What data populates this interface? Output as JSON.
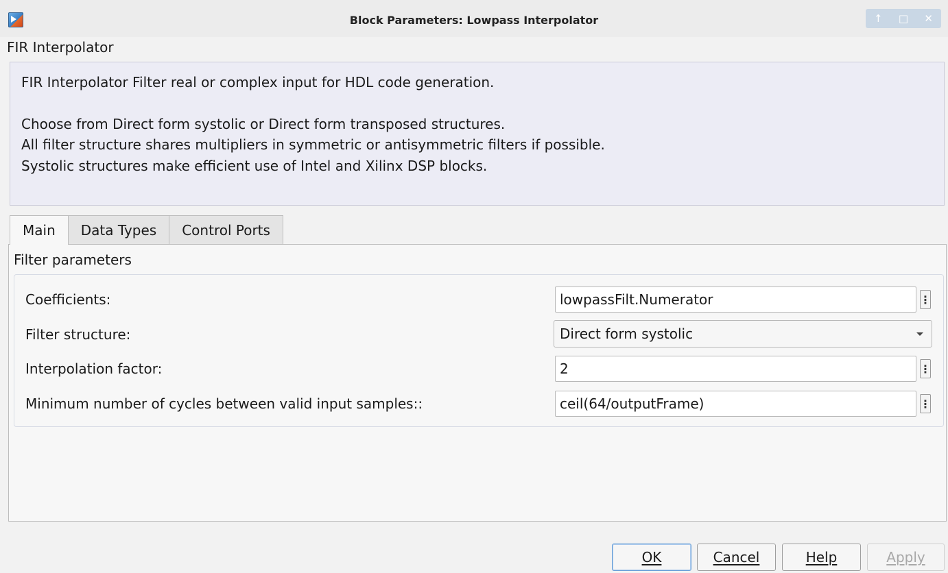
{
  "window": {
    "title": "Block Parameters: Lowpass Interpolator",
    "controls": {
      "minimize": "↑",
      "maximize": "□",
      "close": "✕"
    }
  },
  "block": {
    "name": "FIR Interpolator",
    "description": [
      "FIR Interpolator Filter real or complex input for HDL code generation.",
      "Choose from Direct form systolic or Direct form transposed structures.",
      "All filter structure shares multipliers in symmetric or antisymmetric filters if possible.",
      "Systolic structures make efficient use of Intel and Xilinx DSP blocks."
    ]
  },
  "tabs": [
    {
      "label": "Main",
      "active": true
    },
    {
      "label": "Data Types",
      "active": false
    },
    {
      "label": "Control Ports",
      "active": false
    }
  ],
  "main": {
    "group_label": "Filter parameters",
    "params": {
      "coefficients": {
        "label": "Coefficients:",
        "value": "lowpassFilt.Numerator",
        "more": "⋮"
      },
      "filter_structure": {
        "label": "Filter structure:",
        "value": "Direct form systolic"
      },
      "interpolation_factor": {
        "label": "Interpolation factor:",
        "value": "2",
        "more": "⋮"
      },
      "min_cycles": {
        "label": "Minimum number of cycles between valid input samples::",
        "value": "ceil(64/outputFrame)",
        "more": "⋮"
      }
    }
  },
  "footer": {
    "ok": "OK",
    "cancel": "Cancel",
    "help": "Help",
    "apply": "Apply"
  },
  "icons": {
    "app": "simulink-block-icon",
    "dropdown": "chevron-down-icon"
  }
}
